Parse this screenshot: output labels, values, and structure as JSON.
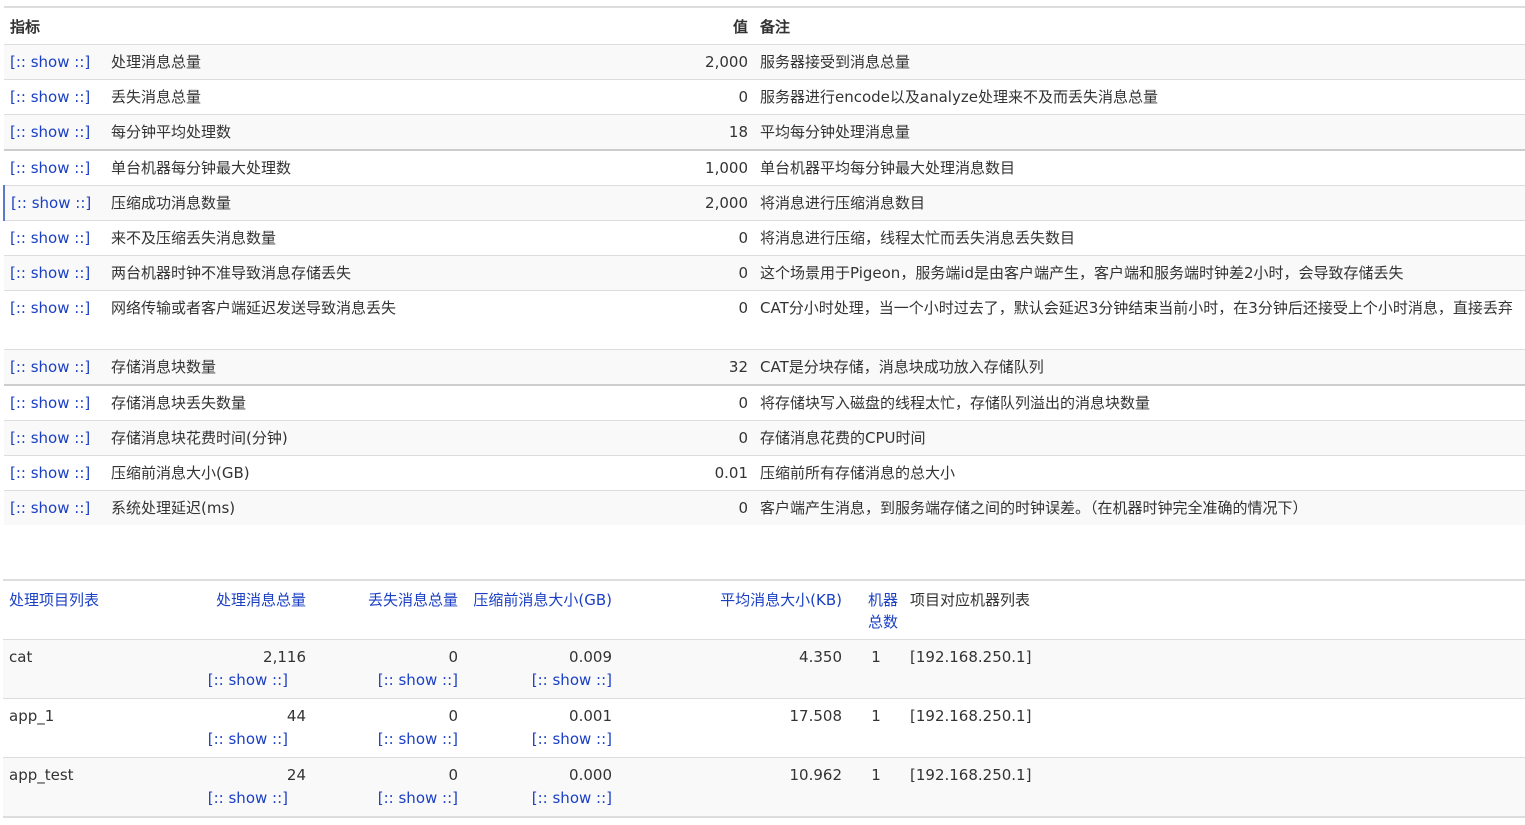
{
  "metrics": {
    "headers": {
      "name": "指标",
      "value": "值",
      "note": "备注"
    },
    "show_label": "[:: show ::]",
    "rows": [
      {
        "name": "处理消息总量",
        "value": "2,000",
        "note": "服务器接受到消息总量"
      },
      {
        "name": "丢失消息总量",
        "value": "0",
        "note": "服务器进行encode以及analyze处理来不及而丢失消息总量"
      },
      {
        "name": "每分钟平均处理数",
        "value": "18",
        "note": "平均每分钟处理消息量"
      },
      {
        "name": "单台机器每分钟最大处理数",
        "value": "1,000",
        "note": "单台机器平均每分钟最大处理消息数目"
      },
      {
        "name": "压缩成功消息数量",
        "value": "2,000",
        "note": "将消息进行压缩消息数目"
      },
      {
        "name": "来不及压缩丢失消息数量",
        "value": "0",
        "note": "将消息进行压缩，线程太忙而丢失消息丢失数目"
      },
      {
        "name": "两台机器时钟不准导致消息存储丢失",
        "value": "0",
        "note": "这个场景用于Pigeon，服务端id是由客户端产生，客户端和服务端时钟差2小时，会导致存储丢失"
      },
      {
        "name": "网络传输或者客户端延迟发送导致消息丢失",
        "value": "0",
        "note": "CAT分小时处理，当一个小时过去了，默认会延迟3分钟结束当前小时，在3分钟后还接受上个小时消息，直接丢弃"
      },
      {
        "name": "存储消息块数量",
        "value": "32",
        "note": "CAT是分块存储，消息块成功放入存储队列"
      },
      {
        "name": "存储消息块丢失数量",
        "value": "0",
        "note": "将存储块写入磁盘的线程太忙，存储队列溢出的消息块数量"
      },
      {
        "name": "存储消息块花费时间(分钟)",
        "value": "0",
        "note": "存储消息花费的CPU时间"
      },
      {
        "name": "压缩前消息大小(GB)",
        "value": "0.01",
        "note": "压缩前所有存储消息的总大小"
      },
      {
        "name": "系统处理延迟(ms)",
        "value": "0",
        "note": "客户端产生消息，到服务端存储之间的时钟误差。（在机器时钟完全准确的情况下）"
      }
    ]
  },
  "projects": {
    "headers": {
      "name": "处理项目列表",
      "total": "处理消息总量",
      "loss": "丢失消息总量",
      "size": "压缩前消息大小(GB)",
      "avg": "平均消息大小(KB)",
      "count": "机器总数",
      "hosts": "项目对应机器列表"
    },
    "show_label": "[:: show ::]",
    "rows": [
      {
        "name": "cat",
        "total": "2,116",
        "loss": "0",
        "size": "0.009",
        "avg": "4.350",
        "count": "1",
        "hosts": "[192.168.250.1]"
      },
      {
        "name": "app_1",
        "total": "44",
        "loss": "0",
        "size": "0.001",
        "avg": "17.508",
        "count": "1",
        "hosts": "[192.168.250.1]"
      },
      {
        "name": "app_test",
        "total": "24",
        "loss": "0",
        "size": "0.000",
        "avg": "10.962",
        "count": "1",
        "hosts": "[192.168.250.1]"
      }
    ]
  },
  "colors": {
    "link": "#1a3fc4",
    "text": "#333333",
    "stripe": "#f9f9f9",
    "border": "#dddddd"
  }
}
